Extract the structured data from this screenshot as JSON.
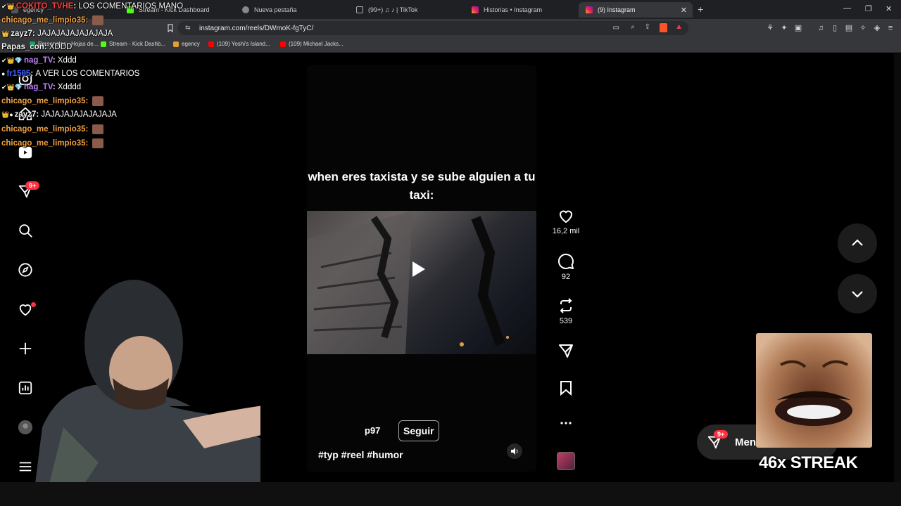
{
  "tabs": [
    {
      "title": "egency",
      "active": false
    },
    {
      "title": "Stream - Kick Dashboard",
      "active": false
    },
    {
      "title": "Nueva pestaña",
      "active": false
    },
    {
      "title": "(99+) ♫ ♪ | TikTok",
      "active": false
    },
    {
      "title": "Historias • Instagram",
      "active": false
    },
    {
      "title": "(9) Instagram",
      "active": true
    }
  ],
  "url": "instagram.com/reels/DWmoK-fgTyC/",
  "bookmarks": [
    {
      "label": "Personales - Hojas de..."
    },
    {
      "label": "Stream - Kick Dashb..."
    },
    {
      "label": "egency"
    },
    {
      "label": "(109) Yoshi's Island..."
    },
    {
      "label": "(109) Michael Jacks..."
    }
  ],
  "chat": [
    {
      "user": "COKITO_TVHE",
      "message": "LOS COMENTARIOS MANO",
      "color": "#ff4040"
    },
    {
      "user": "chicago_me_limpio35",
      "message": "",
      "color": "#f0a040",
      "emote": true
    },
    {
      "user": "zayz7",
      "message": "JAJAJAJAJAJAJAJA",
      "color": "#ffffff"
    },
    {
      "user": "Papas_con",
      "message": "XDDD",
      "color": "#ffffff"
    },
    {
      "user": "nag_TV",
      "message": "Xddd",
      "color": "#c080ff"
    },
    {
      "user": "fr1505",
      "message": "A VER LOS COMENTARIOS",
      "color": "#4060ff"
    },
    {
      "user": "nag_TV",
      "message": "Xdddd",
      "color": "#c080ff"
    },
    {
      "user": "chicago_me_limpio35",
      "message": "",
      "color": "#f0a040",
      "emote": true
    },
    {
      "user": "zayz7",
      "message": "JAJAJAJAJAJAJAJA",
      "color": "#ffffff"
    },
    {
      "user": "chicago_me_limpio35",
      "message": "",
      "color": "#f0a040",
      "emote": true
    },
    {
      "user": "chicago_me_limpio35",
      "message": "",
      "color": "#f0a040",
      "emote": true
    }
  ],
  "sidebar": {
    "messages_badge": "9+"
  },
  "reel": {
    "caption": "when eres taxista y se sube alguien a tu taxi:",
    "username": "p97",
    "follow_label": "Seguir",
    "hashtags": "#typ #reel #humor"
  },
  "actions": {
    "likes": "16,2 mil",
    "comments": "92",
    "reposts": "539"
  },
  "messages_pill": {
    "label": "Men",
    "badge": "9+"
  },
  "streak": {
    "text": "46x STREAK"
  },
  "colors": {
    "accent": "#ff3040",
    "background": "#000000"
  }
}
